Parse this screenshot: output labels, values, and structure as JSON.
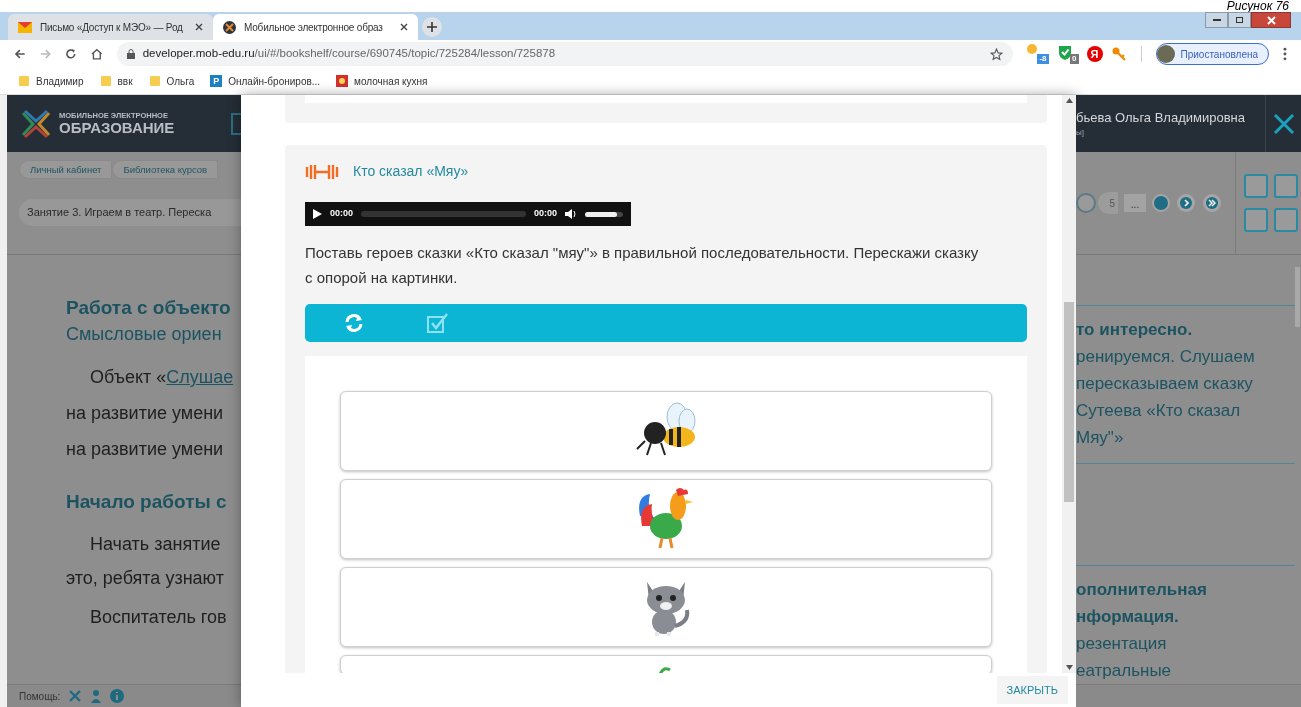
{
  "caption": "Рисунок 76",
  "browser": {
    "tabs": [
      {
        "title": "Письмо «Доступ к МЭО» — Род",
        "kind": "mail",
        "selected": false
      },
      {
        "title": "Мобильное электронное образ",
        "kind": "site",
        "selected": true
      }
    ],
    "url_host": "developer.mob-edu.ru",
    "url_path": "/ui/#/bookshelf/course/690745/topic/725284/lesson/725878",
    "extensions": [
      {
        "kind": "weather",
        "badge": "-8"
      },
      {
        "kind": "shield",
        "badge": "0"
      },
      {
        "kind": "yandex",
        "badge": "Я"
      },
      {
        "kind": "key"
      }
    ],
    "profile": "Приостановлена",
    "bookmarks": [
      {
        "kind": "folder",
        "label": "Владимир"
      },
      {
        "kind": "folder",
        "label": "ввк"
      },
      {
        "kind": "folder",
        "label": "Ольга"
      },
      {
        "kind": "letter",
        "letter": "P",
        "label": "Онлайн-брониров..."
      },
      {
        "kind": "image",
        "label": "молочная кухня"
      }
    ]
  },
  "site": {
    "logo_small": "МОБИЛЬНОЕ ЭЛЕКТРОННОЕ",
    "logo_big": "ОБРАЗОВАНИЕ",
    "user_name": "бьева Ольга Владимировна",
    "user_sub": "ы]",
    "breadcrumbs": [
      "Личный кабинет",
      "Библиотека курсов"
    ],
    "lesson_title": "Занятие 3. Играем в театр. Переска",
    "pager": [
      {
        "kind": "ring"
      },
      {
        "kind": "page",
        "label": "5"
      },
      {
        "kind": "more",
        "label": "..."
      },
      {
        "kind": "dot"
      },
      {
        "kind": "next"
      },
      {
        "kind": "last"
      }
    ],
    "left": {
      "heading": "Работа с объекто",
      "subheading": "Смысловые ориен",
      "paragraph1": {
        "prefix": "Объект «",
        "link": "Слушае",
        "lines": [
          "на развитие умени",
          "на развитие умени"
        ]
      },
      "heading2": "Начало работы с",
      "paragraph2": [
        "Начать занятие",
        "это, ребята узнают"
      ],
      "paragraph3": "Воспитатель гов"
    },
    "right": {
      "block1_title": "то интересно.",
      "block1_lines": [
        "ренируемся. Слушаем",
        "пересказываем сказку",
        "Сутеева «Кто сказал",
        "Мяу\"»"
      ],
      "block2_title": [
        "ополнительная",
        "нформация."
      ],
      "block2_lines": [
        "резентация",
        "еатральные"
      ]
    },
    "help_label": "Помощь:"
  },
  "modal": {
    "exercise_title": "Кто сказал «Мяу»",
    "audio": {
      "time_current": "00:00",
      "time_total": "00:00",
      "progress": {
        "level": 0
      },
      "volume": {
        "level": 0.85
      }
    },
    "instruction": "Поставь героев сказки «Кто сказал \"мяу\"» в правильной последовательности. Перескажи сказку с опорой на картинки.",
    "cards": [
      {
        "kind": "bee"
      },
      {
        "kind": "rooster"
      },
      {
        "kind": "kitten"
      },
      {
        "kind": "partial"
      }
    ],
    "close_button": "ЗАКРЫТЬ"
  }
}
